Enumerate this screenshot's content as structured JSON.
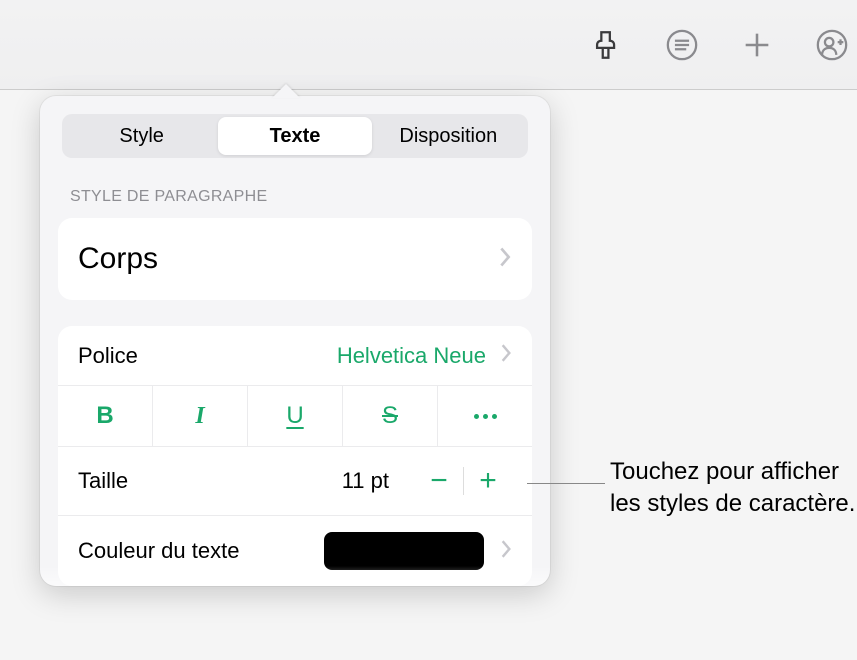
{
  "tabs": {
    "style": "Style",
    "text": "Texte",
    "layout": "Disposition"
  },
  "paragraph_style": {
    "header": "Style de paragraphe",
    "value": "Corps"
  },
  "font": {
    "label": "Police",
    "value": "Helvetica Neue"
  },
  "size": {
    "label": "Taille",
    "value": "11 pt"
  },
  "text_color": {
    "label": "Couleur du texte",
    "value_hex": "#000000"
  },
  "callout": "Touchez pour afficher les styles de caractère."
}
